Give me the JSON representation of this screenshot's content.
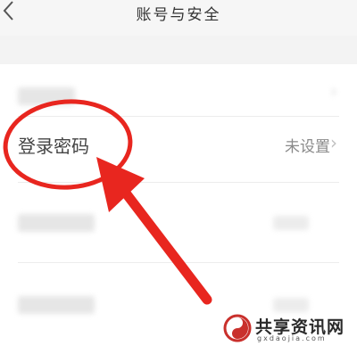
{
  "header": {
    "back_icon": "chevron-left-icon",
    "title": "账号与安全"
  },
  "rows": [
    {
      "label": "",
      "value": "",
      "chevron_icon": "chevron-right-icon",
      "blurred": true
    },
    {
      "label": "登录密码",
      "value": "未设置",
      "chevron_icon": "chevron-right-icon",
      "blurred": false
    },
    {
      "label": "",
      "value": "",
      "chevron_icon": "chevron-right-icon",
      "blurred": true
    },
    {
      "label": "",
      "value": "",
      "chevron_icon": "chevron-right-icon",
      "blurred": true
    }
  ],
  "annotation": {
    "color": "#e8261f",
    "shapes": [
      "circle-highlight",
      "arrow-pointer"
    ]
  },
  "watermark": {
    "name": "共享资讯网",
    "url": "gxdaojia.com",
    "logo": "swirl-logo-icon"
  }
}
